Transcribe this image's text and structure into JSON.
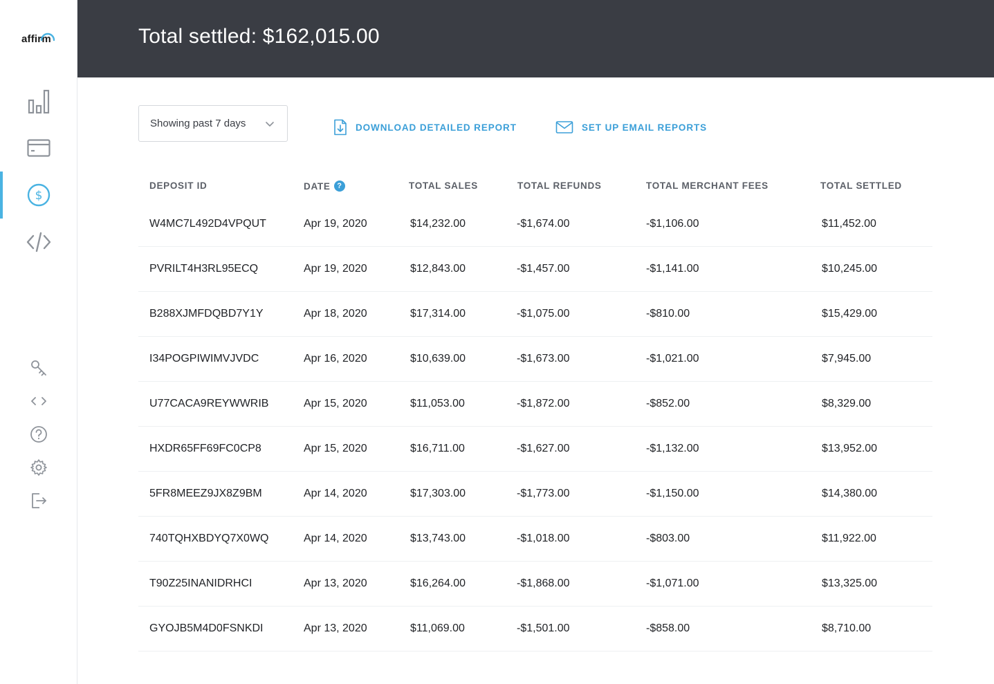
{
  "brand": {
    "name": "affirm"
  },
  "colors": {
    "accent": "#3b9fd8",
    "header_bg": "#3a3d44",
    "active_bar": "#4ab3e2",
    "icon": "#8e939a"
  },
  "sidebar": {
    "nav": [
      {
        "icon": "bar-chart-icon"
      },
      {
        "icon": "credit-card-icon"
      },
      {
        "icon": "dollar-circle-icon",
        "active": true
      },
      {
        "icon": "code-icon"
      }
    ],
    "utility": [
      {
        "icon": "key-icon"
      },
      {
        "icon": "code-small-icon"
      },
      {
        "icon": "help-icon"
      },
      {
        "icon": "gear-icon"
      },
      {
        "icon": "logout-icon"
      }
    ]
  },
  "header": {
    "title": "Total settled: $162,015.00"
  },
  "toolbar": {
    "filter_label": "Showing past 7 days",
    "download_label": "DOWNLOAD DETAILED REPORT",
    "email_label": "SET UP EMAIL REPORTS"
  },
  "table": {
    "columns": [
      "DEPOSIT ID",
      "DATE",
      "TOTAL SALES",
      "TOTAL REFUNDS",
      "TOTAL MERCHANT FEES",
      "TOTAL SETTLED"
    ],
    "date_help": "?",
    "rows": [
      [
        "W4MC7L492D4VPQUT",
        "Apr 19, 2020",
        "$14,232.00",
        "-$1,674.00",
        "-$1,106.00",
        "$11,452.00"
      ],
      [
        "PVRILT4H3RL95ECQ",
        "Apr 19, 2020",
        "$12,843.00",
        "-$1,457.00",
        "-$1,141.00",
        "$10,245.00"
      ],
      [
        "B288XJMFDQBD7Y1Y",
        "Apr 18, 2020",
        "$17,314.00",
        "-$1,075.00",
        "-$810.00",
        "$15,429.00"
      ],
      [
        "I34POGPIWIMVJVDC",
        "Apr 16, 2020",
        "$10,639.00",
        "-$1,673.00",
        "-$1,021.00",
        "$7,945.00"
      ],
      [
        "U77CACA9REYWWRIB",
        "Apr 15, 2020",
        "$11,053.00",
        "-$1,872.00",
        "-$852.00",
        "$8,329.00"
      ],
      [
        "HXDR65FF69FC0CP8",
        "Apr 15, 2020",
        "$16,711.00",
        "-$1,627.00",
        "-$1,132.00",
        "$13,952.00"
      ],
      [
        "5FR8MEEZ9JX8Z9BM",
        "Apr 14, 2020",
        "$17,303.00",
        "-$1,773.00",
        "-$1,150.00",
        "$14,380.00"
      ],
      [
        "740TQHXBDYQ7X0WQ",
        "Apr 14, 2020",
        "$13,743.00",
        "-$1,018.00",
        "-$803.00",
        "$11,922.00"
      ],
      [
        "T90Z25INANIDRHCI",
        "Apr 13, 2020",
        "$16,264.00",
        "-$1,868.00",
        "-$1,071.00",
        "$13,325.00"
      ],
      [
        "GYOJB5M4D0FSNKDI",
        "Apr 13, 2020",
        "$11,069.00",
        "-$1,501.00",
        "-$858.00",
        "$8,710.00"
      ]
    ]
  }
}
